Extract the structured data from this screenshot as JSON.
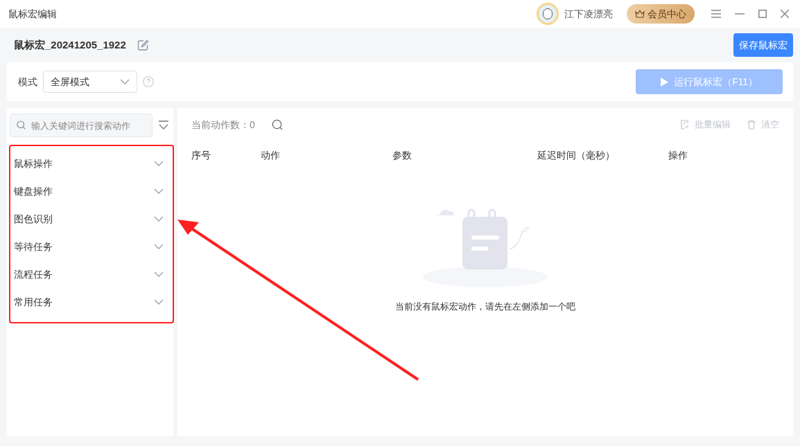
{
  "window": {
    "title": "鼠标宏编辑"
  },
  "user": {
    "name": "江下凌漂亮"
  },
  "vip_button": {
    "label": "会员中心"
  },
  "macro": {
    "name": "鼠标宏_20241205_1922"
  },
  "save_button": {
    "label": "保存鼠标宏"
  },
  "mode": {
    "label": "模式",
    "value": "全屏模式"
  },
  "run_button": {
    "label": "运行鼠标宏（F11）",
    "disabled": true
  },
  "search": {
    "placeholder": "输入关键词进行搜索动作"
  },
  "categories": [
    {
      "label": "鼠标操作",
      "expanded": false
    },
    {
      "label": "键盘操作",
      "expanded": false
    },
    {
      "label": "图色识别",
      "expanded": false
    },
    {
      "label": "等待任务",
      "expanded": false
    },
    {
      "label": "流程任务",
      "expanded": false
    },
    {
      "label": "常用任务",
      "expanded": false
    }
  ],
  "action_count": {
    "label": "当前动作数：",
    "value": "0"
  },
  "toolbar": [
    {
      "label": "批量编辑",
      "kind": "edit",
      "disabled": true
    },
    {
      "label": "清空",
      "kind": "clear",
      "disabled": true
    }
  ],
  "table": {
    "columns": [
      "序号",
      "动作",
      "参数",
      "延迟时间（毫秒）",
      "操作"
    ]
  },
  "empty_message": "当前没有鼠标宏动作，请先在左侧添加一个吧"
}
